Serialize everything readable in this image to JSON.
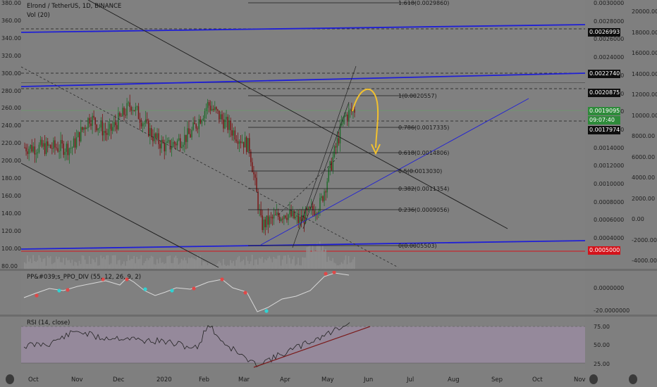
{
  "header": {
    "title": "Elrond / TetherUS, 1D, BINANCE",
    "volume_label": "Vol (20)"
  },
  "price_axis": [
    "380.00",
    "360.00",
    "340.00",
    "320.00",
    "300.00",
    "280.00",
    "260.00",
    "240.00",
    "220.00",
    "200.00",
    "180.00",
    "160.00",
    "140.00",
    "120.00",
    "100.00",
    "80.00"
  ],
  "right_price_axis": [
    "0.0030000",
    "0.0028000",
    "0.0026000",
    "0.0024000",
    "0.0022000",
    "0.0020000",
    "0.0018000",
    "0.0016000",
    "0.0014000",
    "0.0012000",
    "0.0010000",
    "0.0008000",
    "0.0006000",
    "0.0004000"
  ],
  "volume_axis": [
    "20000.00",
    "18000.00",
    "16000.00",
    "14000.00",
    "12000.00",
    "10000.00",
    "8000.00",
    "6000.00",
    "4000.00",
    "2000.00",
    "0.00",
    "-2000.00",
    "-4000.00"
  ],
  "price_badges": [
    {
      "text": "0.0026993",
      "bg": "#0e0e0e"
    },
    {
      "text": "0.0022740",
      "bg": "#0e0e0e"
    },
    {
      "text": "0.0020875",
      "bg": "#0e0e0e"
    },
    {
      "text": "0.0019095",
      "bg": "#2e8b3a"
    },
    {
      "text": "09:07:40",
      "bg": "#2e8b3a"
    },
    {
      "text": "0.0017974",
      "bg": "#0e0e0e"
    },
    {
      "text": "0.0005000",
      "bg": "#d4121a"
    }
  ],
  "fib_labels": [
    "1.618(0.0029860)",
    "1(0.0020557)",
    "0.786(0.0017335)",
    "0.618(0.0014806)",
    "0.5(0.0013030)",
    "0.382(0.0011354)",
    "0.236(0.0009056)",
    "0(0.0005503)"
  ],
  "ppo": {
    "label": "PP&#039;s_PPO_DIV (55, 12, 26, 9, 2)",
    "axis": [
      "0.0000000",
      "-20.0000000"
    ]
  },
  "rsi": {
    "label": "RSI (14, close)",
    "axis": [
      "75.00",
      "50.00",
      "25.00"
    ]
  },
  "time_axis": [
    "Oct",
    "Nov",
    "Dec",
    "2020",
    "Feb",
    "Mar",
    "Apr",
    "May",
    "Jun",
    "Jul",
    "Aug",
    "Sep",
    "Oct",
    "Nov"
  ],
  "colors": {
    "channel_blue": "#1f1fd6",
    "trend_black": "#1a1a1a",
    "candle_up": "#1e6b2a",
    "candle_down": "#7a1212",
    "arrow_yellow": "#f2c12e",
    "rsi_band": "#a58fb0",
    "support_red": "#d4121a"
  },
  "chart_data": {
    "type": "candlestick",
    "symbol": "Elrond / TetherUS",
    "interval": "1D",
    "exchange": "BINANCE",
    "x": [
      "Oct",
      "Nov",
      "Dec",
      "2020",
      "Feb",
      "Mar",
      "Apr",
      "May",
      "Jun"
    ],
    "close_approx": [
      214,
      245,
      265,
      222,
      268,
      225,
      128,
      150,
      255
    ],
    "fib_levels": [
      {
        "ratio": 1.618,
        "price": 0.002986
      },
      {
        "ratio": 1,
        "price": 0.0020557
      },
      {
        "ratio": 0.786,
        "price": 0.0017335
      },
      {
        "ratio": 0.618,
        "price": 0.0014806
      },
      {
        "ratio": 0.5,
        "price": 0.001303
      },
      {
        "ratio": 0.382,
        "price": 0.0011354
      },
      {
        "ratio": 0.236,
        "price": 0.0009056
      },
      {
        "ratio": 0,
        "price": 0.0005503
      }
    ],
    "ylim": [
      80,
      380
    ],
    "rsi_band": [
      25,
      75
    ]
  }
}
